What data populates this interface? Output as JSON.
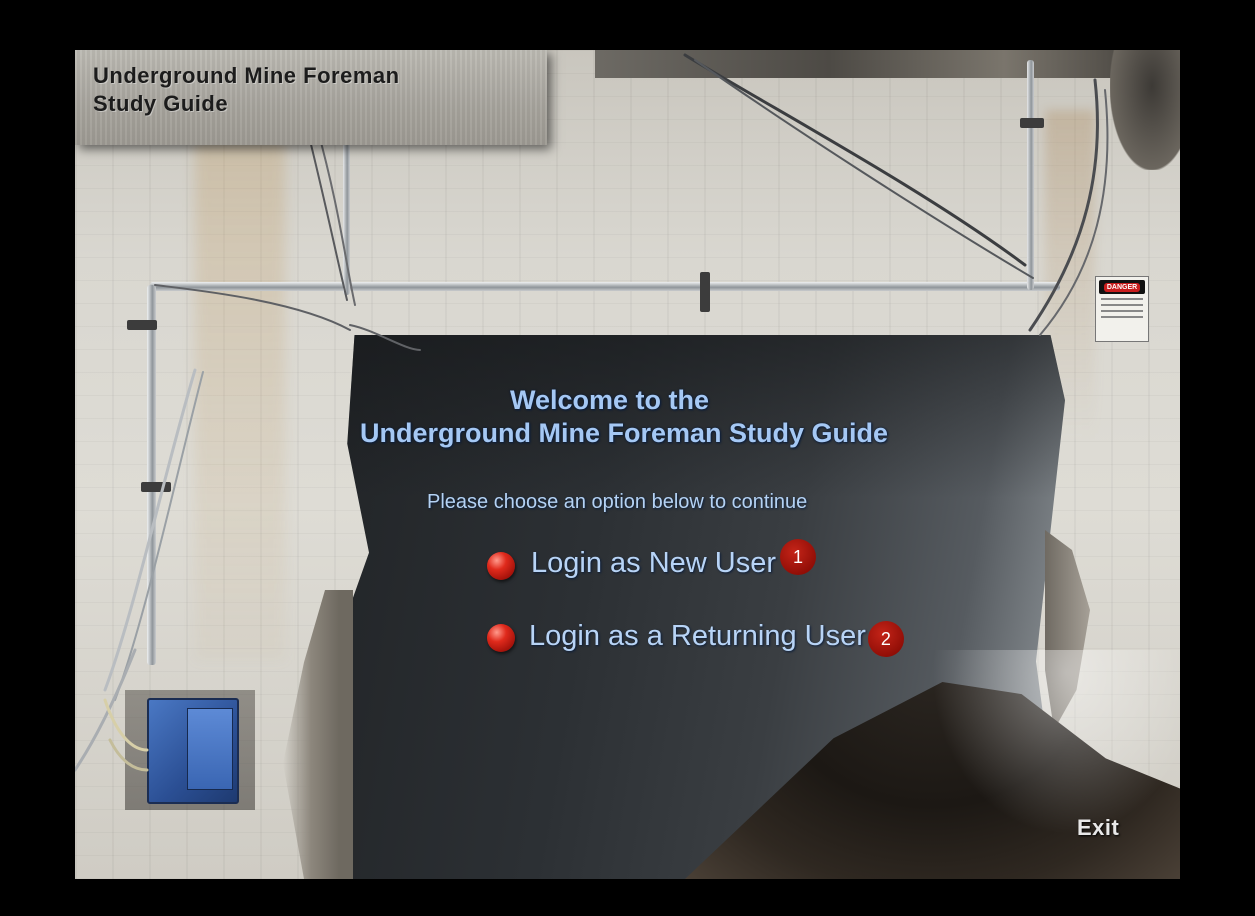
{
  "app": {
    "title_line1": "Underground Mine Foreman",
    "title_line2": "Study Guide"
  },
  "welcome": {
    "line1": "Welcome to the",
    "line2": "Underground Mine Foreman Study Guide",
    "instruction": "Please choose an option below to continue"
  },
  "options": [
    {
      "label": "Login as New User",
      "badge": "1",
      "icon": "red-bullet-icon"
    },
    {
      "label": "Login as a Returning User",
      "badge": "2",
      "icon": "red-bullet-icon"
    }
  ],
  "footer": {
    "exit_label": "Exit"
  },
  "scene": {
    "sign_text": "DANGER"
  },
  "colors": {
    "heading": "#a5c8f4",
    "bullet": "#e02a1c",
    "badge": "#8f0d06",
    "background": "#000000"
  }
}
